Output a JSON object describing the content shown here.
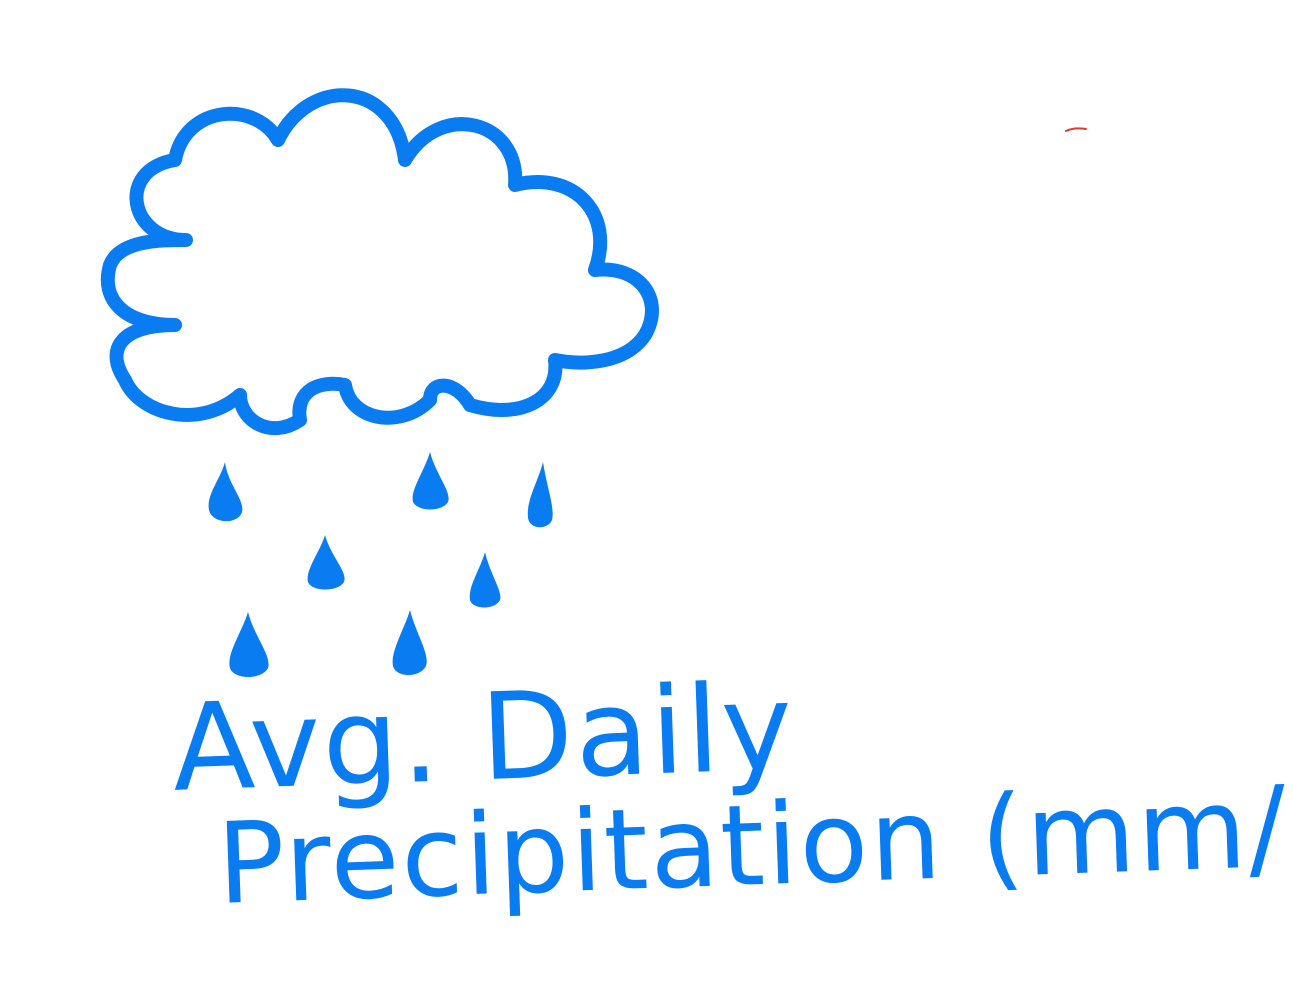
{
  "sketch": {
    "ink_color": "#0A7CF2",
    "accent_color": "#E53935",
    "icon": "rain-cloud-icon",
    "label_line1": "Avg. Daily",
    "label_line2": "Precipitation (mm/day)"
  }
}
